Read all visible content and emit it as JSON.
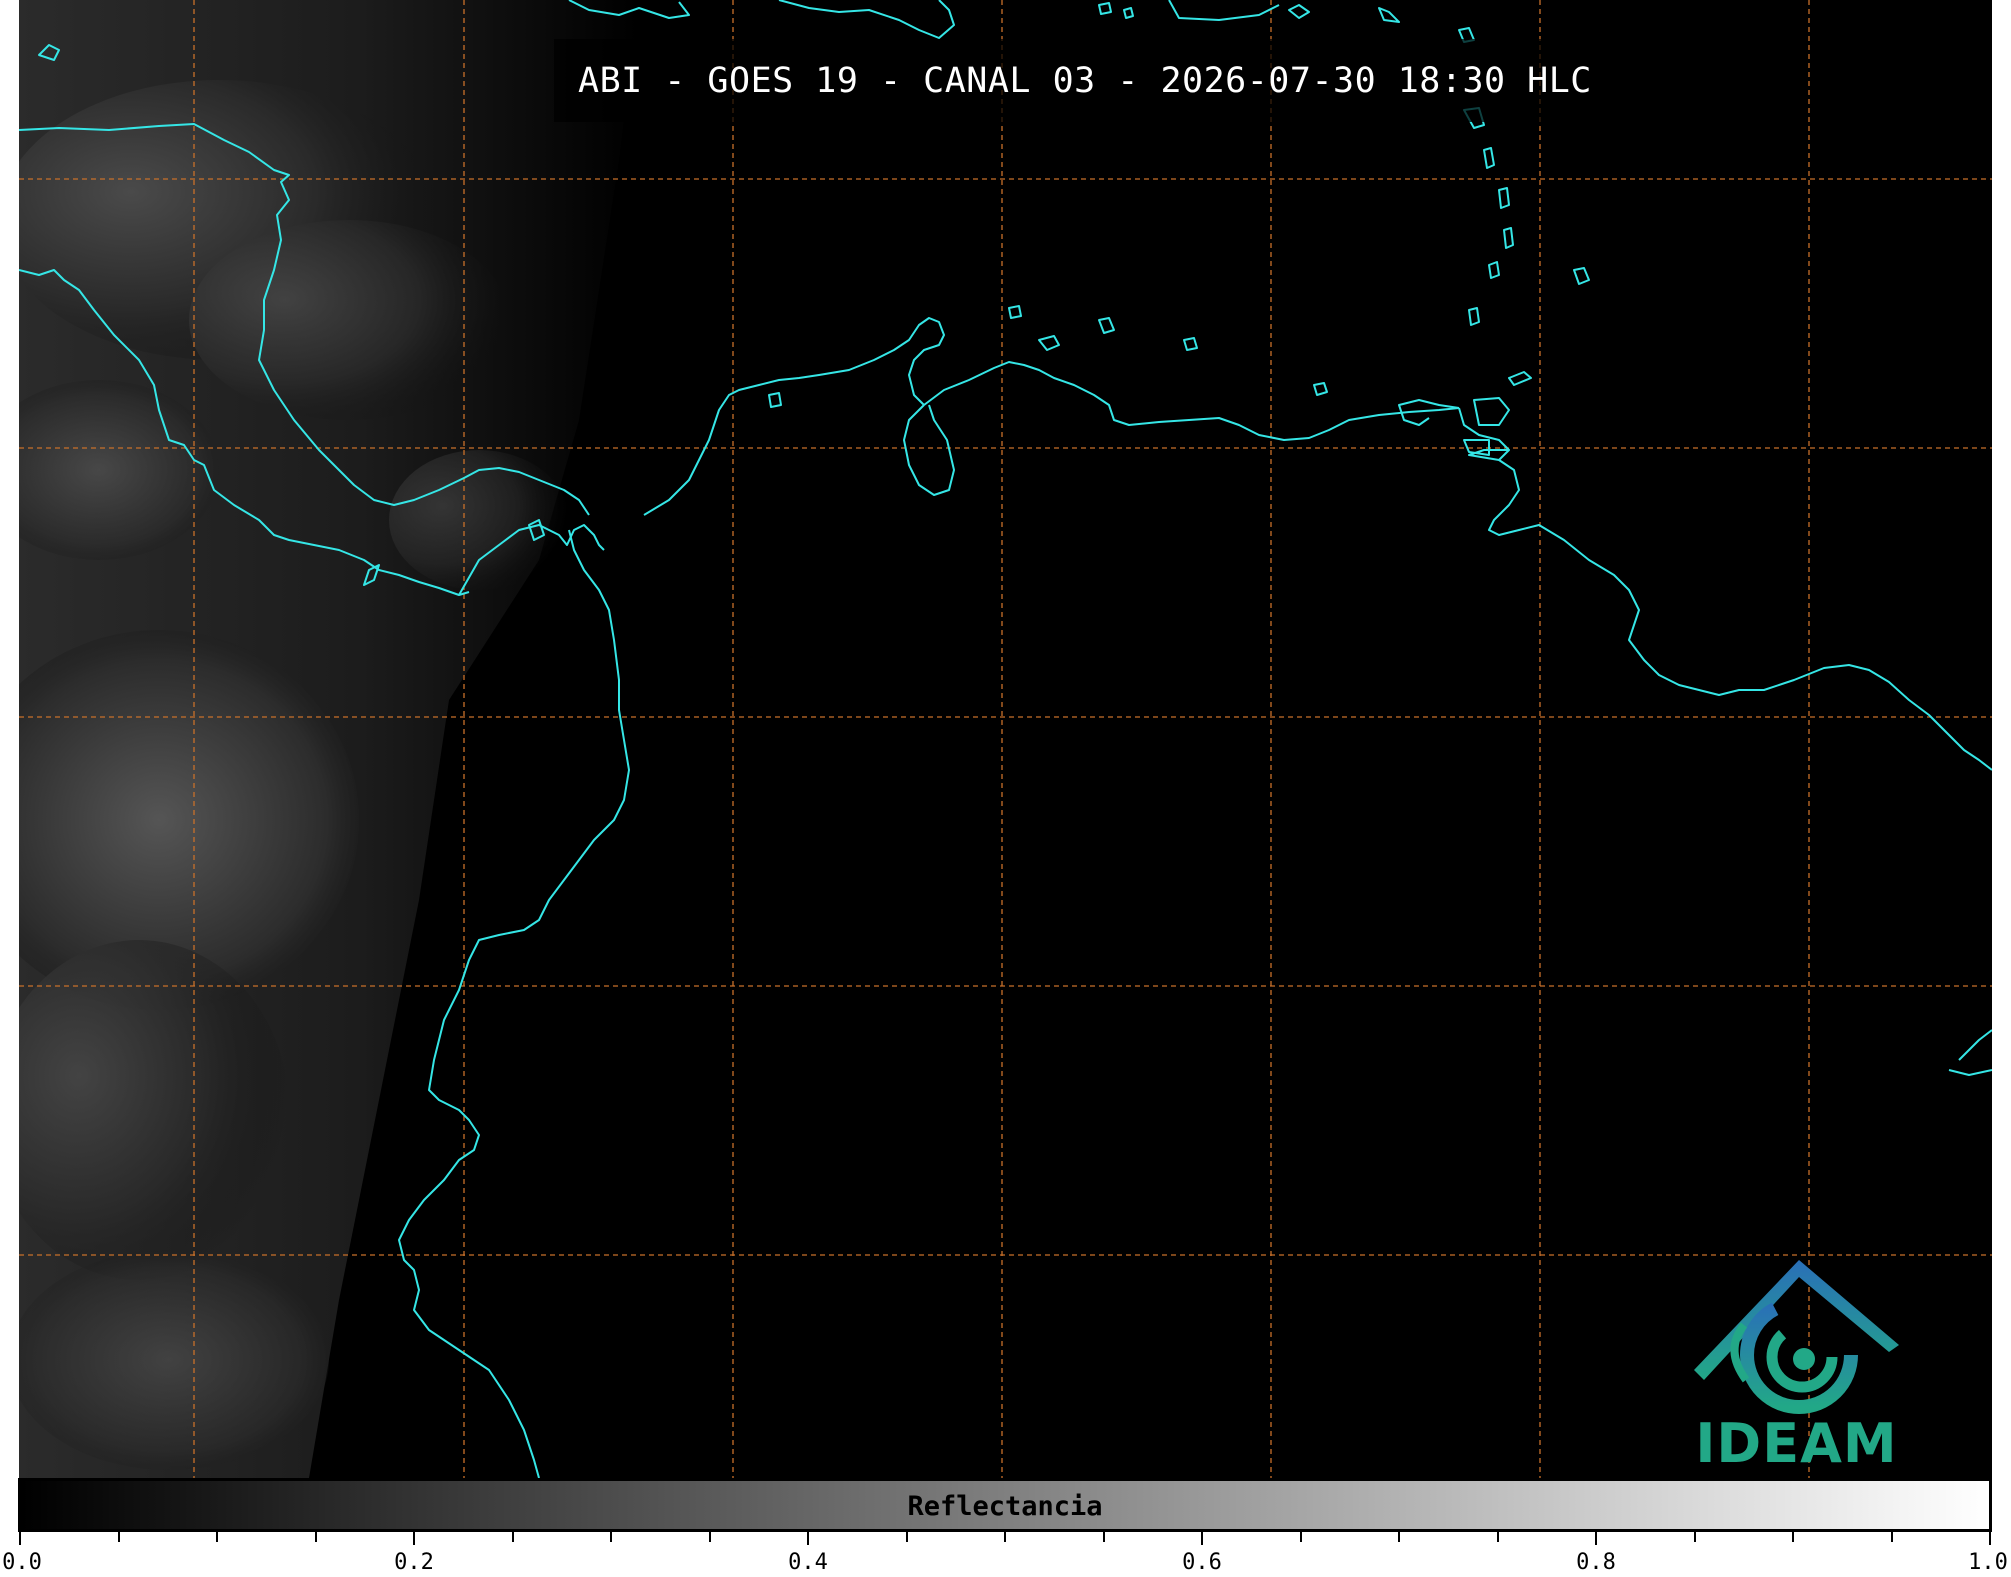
{
  "title": "ABI - GOES 19 - CANAL 03 - 2026-07-30 18:30 HLC",
  "colorbar": {
    "label": "Reflectancia",
    "ticks": [
      "0.0",
      "0.2",
      "0.4",
      "0.6",
      "0.8",
      "1.0"
    ],
    "range": [
      0.0,
      1.0
    ],
    "gradient_from": "#000000",
    "gradient_to": "#ffffff"
  },
  "logo": {
    "text": "IDEAM",
    "colors": [
      "#2a7fb8",
      "#22a887"
    ]
  },
  "map": {
    "coastline_color": "#35e6e6",
    "grid_color": "#c8702a",
    "grid_style": "dashed",
    "background": "#000000"
  }
}
